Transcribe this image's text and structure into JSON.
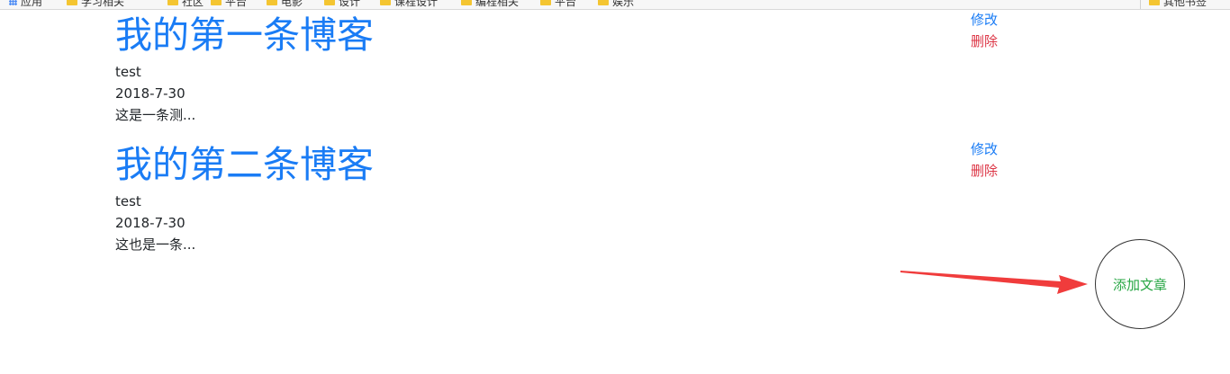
{
  "bookmarks": [
    {
      "label": "应用",
      "icon": "apps-icon"
    },
    {
      "label": "学习相关",
      "icon": "folder-icon"
    },
    {
      "label": "社区",
      "icon": "folder-icon"
    },
    {
      "label": "平台",
      "icon": "folder-icon"
    },
    {
      "label": "电影",
      "icon": "folder-icon"
    },
    {
      "label": "设计",
      "icon": "folder-icon"
    },
    {
      "label": "课程设计",
      "icon": "folder-icon"
    },
    {
      "label": "编程相关",
      "icon": "folder-icon"
    },
    {
      "label": "平台",
      "icon": "folder-icon"
    },
    {
      "label": "娱乐",
      "icon": "folder-icon"
    },
    {
      "label": "其他书签",
      "icon": "folder-icon"
    }
  ],
  "posts": [
    {
      "title": "我的第一条博客",
      "author": "test",
      "date": "2018-7-30",
      "excerpt": "这是一条测...",
      "edit_label": "修改",
      "delete_label": "删除"
    },
    {
      "title": "我的第二条博客",
      "author": "test",
      "date": "2018-7-30",
      "excerpt": "这也是一条...",
      "edit_label": "修改",
      "delete_label": "删除"
    }
  ],
  "add_button": {
    "label": "添加文章"
  },
  "colors": {
    "link": "#1a7cf5",
    "danger": "#dc3545",
    "success": "#28a745",
    "annotation_arrow": "#f03c3c"
  }
}
